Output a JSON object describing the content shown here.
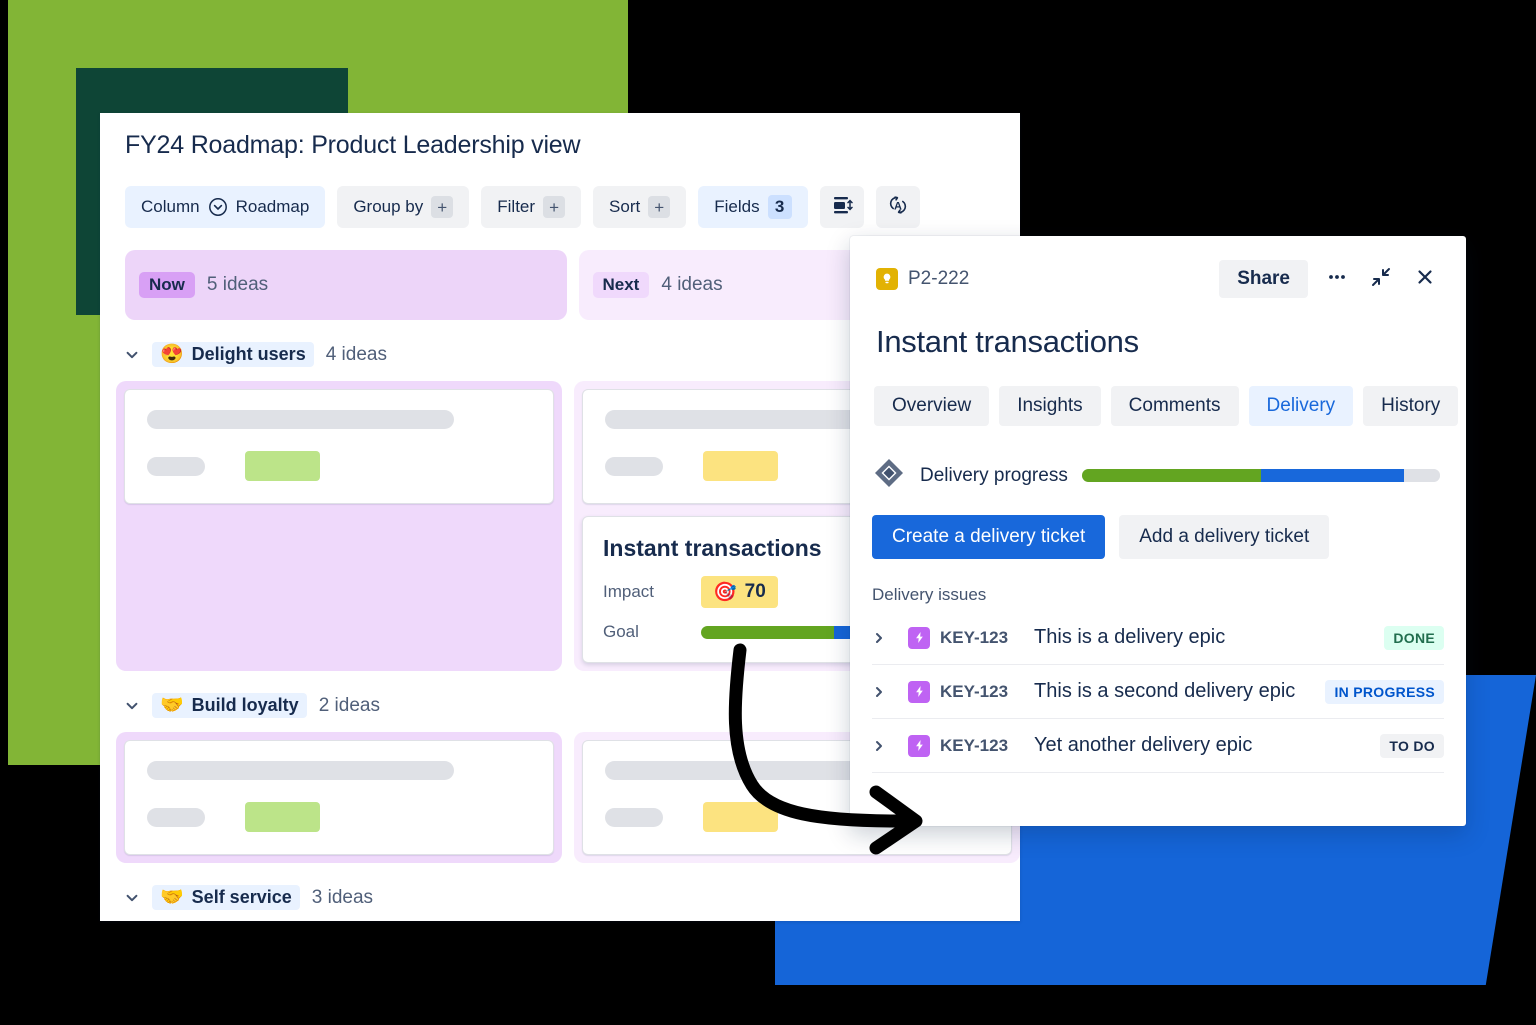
{
  "colors": {
    "green_light": "#82B536",
    "green_dark": "#0E4536",
    "blue": "#1565D8",
    "accent_blue": "#1868DB",
    "progress_green": "#63A521",
    "epic_purple": "#BF63F3",
    "idea_yellow": "#E2B203"
  },
  "window": {
    "title": "FY24 Roadmap: Product Leadership view",
    "toolbar": {
      "column_label": "Column",
      "column_value": "Roadmap",
      "group_by_label": "Group by",
      "group_by_plus": "+",
      "filter_label": "Filter",
      "filter_plus": "+",
      "sort_label": "Sort",
      "sort_plus": "+",
      "fields_label": "Fields",
      "fields_count": "3",
      "density_icon": "row-height-icon",
      "translate_icon": "auto-translate-icon",
      "chevron_icon": "chevron-down-circle-icon"
    },
    "columns": [
      {
        "pill": "Now",
        "count": "5 ideas"
      },
      {
        "pill": "Next",
        "count": "4 ideas"
      }
    ],
    "groups": [
      {
        "emoji": "😍",
        "label": "Delight users",
        "count": "4 ideas"
      },
      {
        "emoji": "🤝",
        "label": "Build loyalty",
        "count": "2 ideas"
      },
      {
        "emoji": "🤝",
        "label": "Self service",
        "count": "3 ideas"
      }
    ],
    "idea_card": {
      "title": "Instant transactions",
      "impact_label": "Impact",
      "impact_emoji": "🎯",
      "impact_value": "70",
      "goal_label": "Goal",
      "goal_green_pct": 62,
      "goal_blue_pct": 38
    }
  },
  "panel": {
    "key": "P2-222",
    "key_icon": "lightbulb-icon",
    "share_label": "Share",
    "more_icon": "more-actions-icon",
    "collapse_icon": "collapse-icon",
    "close_icon": "close-icon",
    "title": "Instant transactions",
    "tabs": [
      {
        "label": "Overview",
        "active": false
      },
      {
        "label": "Insights",
        "active": false
      },
      {
        "label": "Comments",
        "active": false
      },
      {
        "label": "Delivery",
        "active": true
      },
      {
        "label": "History",
        "active": false
      }
    ],
    "delivery": {
      "progress_label": "Delivery progress",
      "progress_icon": "jira-diamond-icon",
      "progress_green_pct": 50,
      "progress_blue_pct": 40,
      "progress_grey_pct": 10,
      "create_ticket_label": "Create a delivery ticket",
      "add_ticket_label": "Add a delivery ticket",
      "issues_heading": "Delivery issues",
      "issues": [
        {
          "key": "KEY-123",
          "summary": "This is a delivery epic",
          "status": "DONE",
          "status_kind": "done"
        },
        {
          "key": "KEY-123",
          "summary": "This is a second delivery epic",
          "status": "IN PROGRESS",
          "status_kind": "progress"
        },
        {
          "key": "KEY-123",
          "summary": "Yet another delivery epic",
          "status": "TO DO",
          "status_kind": "todo"
        }
      ]
    }
  }
}
